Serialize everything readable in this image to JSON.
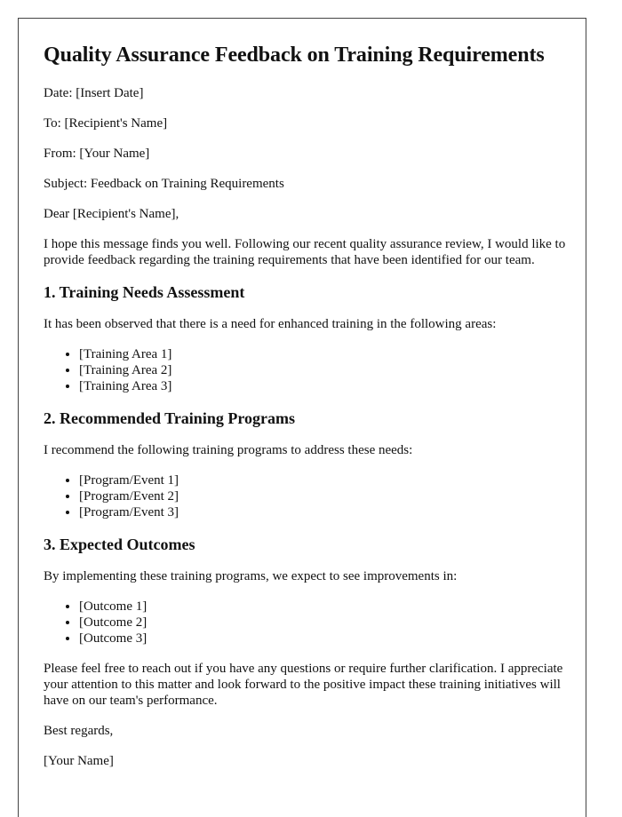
{
  "title": "Quality Assurance Feedback on Training Requirements",
  "header": {
    "date": "Date: [Insert Date]",
    "to": "To: [Recipient's Name]",
    "from": "From: [Your Name]",
    "subject": "Subject: Feedback on Training Requirements"
  },
  "salutation": "Dear [Recipient's Name],",
  "intro": "I hope this message finds you well. Following our recent quality assurance review, I would like to provide feedback regarding the training requirements that have been identified for our team.",
  "sections": [
    {
      "heading": "1. Training Needs Assessment",
      "text": "It has been observed that there is a need for enhanced training in the following areas:",
      "items": [
        "[Training Area 1]",
        "[Training Area 2]",
        "[Training Area 3]"
      ]
    },
    {
      "heading": "2. Recommended Training Programs",
      "text": "I recommend the following training programs to address these needs:",
      "items": [
        "[Program/Event 1]",
        "[Program/Event 2]",
        "[Program/Event 3]"
      ]
    },
    {
      "heading": "3. Expected Outcomes",
      "text": "By implementing these training programs, we expect to see improvements in:",
      "items": [
        "[Outcome 1]",
        "[Outcome 2]",
        "[Outcome 3]"
      ]
    }
  ],
  "closing_paragraph": "Please feel free to reach out if you have any questions or require further clarification. I appreciate your attention to this matter and look forward to the positive impact these training initiatives will have on our team's performance.",
  "signoff": "Best regards,",
  "signature": "[Your Name]"
}
